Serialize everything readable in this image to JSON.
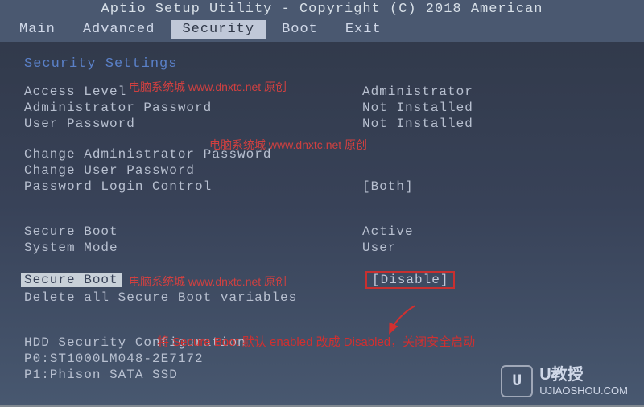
{
  "header": "Aptio Setup Utility - Copyright (C) 2018 American",
  "tabs": {
    "items": [
      "Main",
      "Advanced",
      "Security",
      "Boot",
      "Exit"
    ],
    "active": "Security"
  },
  "section_title": "Security Settings",
  "rows": {
    "access_level": {
      "label": "Access Level",
      "value": "Administrator"
    },
    "admin_password": {
      "label": "Administrator Password",
      "value": "Not Installed"
    },
    "user_password": {
      "label": "User Password",
      "value": "Not Installed"
    },
    "change_admin": {
      "label": "Change Administrator Password"
    },
    "change_user": {
      "label": "Change User Password"
    },
    "login_control": {
      "label": "Password Login Control",
      "value": "[Both]"
    },
    "secure_boot_status": {
      "label": "Secure Boot",
      "value": "Active"
    },
    "system_mode": {
      "label": "System Mode",
      "value": "User"
    },
    "secure_boot": {
      "label": "Secure Boot",
      "value": "[Disable]"
    },
    "delete_vars": {
      "label": "Delete all Secure Boot variables"
    },
    "hdd_config": {
      "label": "HDD Security Configuration"
    },
    "drive0": {
      "label": "P0:ST1000LM048-2E7172"
    },
    "drive1": {
      "label": "P1:Phison SATA SSD"
    }
  },
  "watermarks": {
    "wm1": "电脑系统城 www.dnxtc.net 原创",
    "wm2": "电脑系统城 www.dnxtc.net 原创",
    "wm3": "电脑系统城 www.dnxtc.net 原创"
  },
  "annotation": "将 Secure Boot 默认 enabled 改成 Disabled，关闭安全启动",
  "footer": {
    "badge": "U",
    "primary": "U教授",
    "secondary": "UJIAOSHOU.COM"
  }
}
